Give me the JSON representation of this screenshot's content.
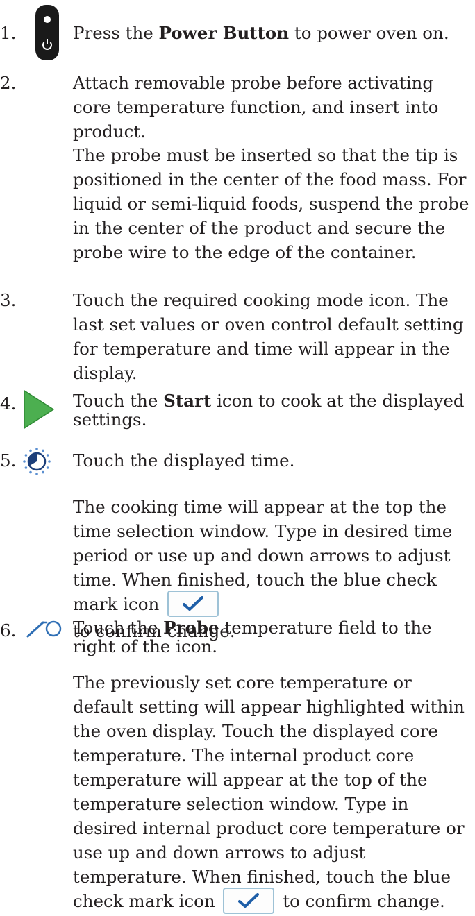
{
  "steps": [
    {
      "num": "1.",
      "pre": "Press the ",
      "bold": "Power Button",
      "post": " to power oven on.",
      "icon": "power-button-icon"
    },
    {
      "num": "2.",
      "text": "Attach removable probe before activating core temperature function, and insert into product.",
      "note": "The probe must be inserted so that the tip is positioned in the center of the food mass. For liquid or semi-liquid foods, suspend the probe in the center of the product and secure the probe wire to the edge of the container."
    },
    {
      "num": "3.",
      "text": "Touch the required cooking mode icon. The last set values or oven control default setting for temperature and time will appear in the display."
    },
    {
      "num": "4.",
      "pre": "Touch the ",
      "bold": "Start",
      "post": " icon to cook at the displayed settings.",
      "icon": "start-play-icon"
    },
    {
      "num": "5.",
      "text": "Touch the displayed time.",
      "icon": "timer-icon",
      "note_pre": "The cooking time will appear at the top the time selection window. Type in desired time period or use up and down arrows to adjust time. When finished, touch the blue check mark icon",
      "note_post": "to confirm change."
    },
    {
      "num": "6.",
      "pre": "Touch the ",
      "bold": "Probe",
      "post": " temperature field to the right of the icon.",
      "icon": "probe-icon",
      "note_pre": "The previously set core temperature or default setting will appear highlighted within the oven display. Touch the displayed core temperature. The internal product core temperature will appear at the top of the temperature selection window. Type in desired internal product core temperature or use up and down arrows to adjust temperature. When finished, touch the blue check mark icon",
      "note_post": "to confirm change."
    }
  ],
  "colors": {
    "text": "#231f20",
    "start_green": "#4caf50",
    "probe_blue": "#2f6fb5",
    "check_blue": "#1f5fa8"
  }
}
